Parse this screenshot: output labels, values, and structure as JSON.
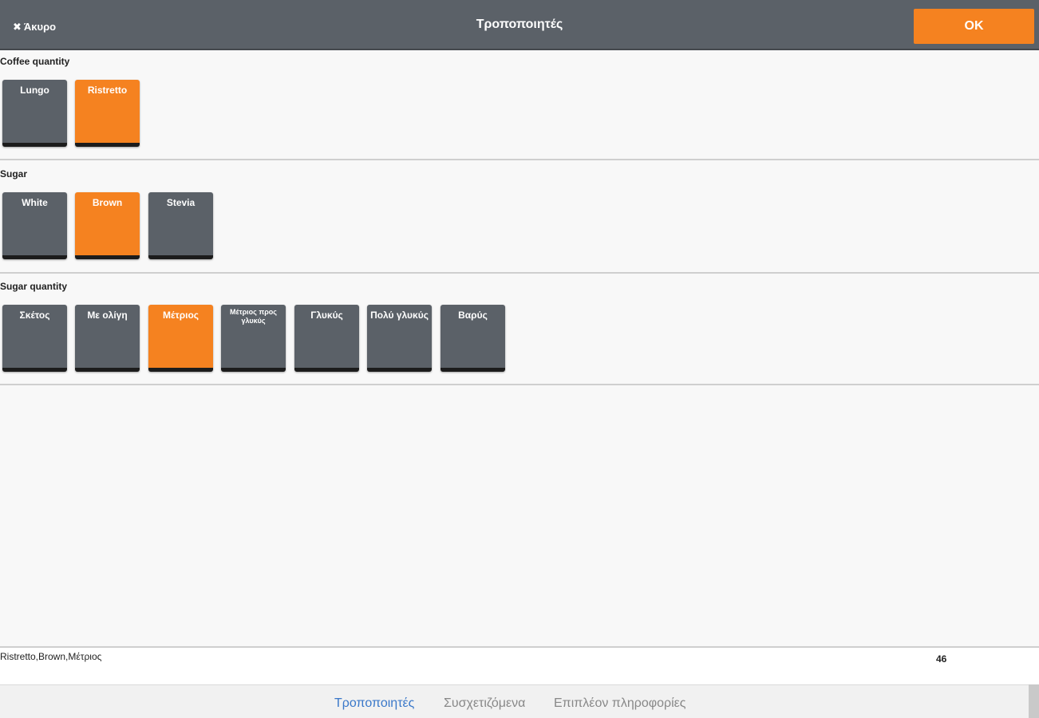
{
  "header": {
    "cancel_label": "Άκυρο",
    "title": "Τροποποιητές",
    "ok_label": "OK"
  },
  "groups": [
    {
      "label": "Coffee quantity",
      "options": [
        {
          "label": "Lungo",
          "selected": false
        },
        {
          "label": "Ristretto",
          "selected": true
        }
      ]
    },
    {
      "label": "Sugar",
      "options": [
        {
          "label": "White",
          "selected": false
        },
        {
          "label": "Brown",
          "selected": true
        },
        {
          "label": "Stevia",
          "selected": false
        }
      ]
    },
    {
      "label": "Sugar quantity",
      "options": [
        {
          "label": "Σκέτος",
          "selected": false
        },
        {
          "label": "Με ολίγη",
          "selected": false
        },
        {
          "label": "Μέτριος",
          "selected": true
        },
        {
          "label": "Μέτριος προς γλυκύς",
          "selected": false
        },
        {
          "label": "Γλυκύς",
          "selected": false
        },
        {
          "label": "Πολύ γλυκύς",
          "selected": false
        },
        {
          "label": "Βαρύς",
          "selected": false
        }
      ]
    }
  ],
  "summary": {
    "text": "Ristretto,Brown,Μέτριος",
    "count": "46"
  },
  "tabs": [
    {
      "label": "Τροποποιητές",
      "active": true
    },
    {
      "label": "Συσχετιζόμενα",
      "active": false
    },
    {
      "label": "Επιπλέον πληροφορίες",
      "active": false
    }
  ],
  "colors": {
    "accent": "#f58220",
    "button": "#5b6168",
    "link": "#3a78c9"
  }
}
